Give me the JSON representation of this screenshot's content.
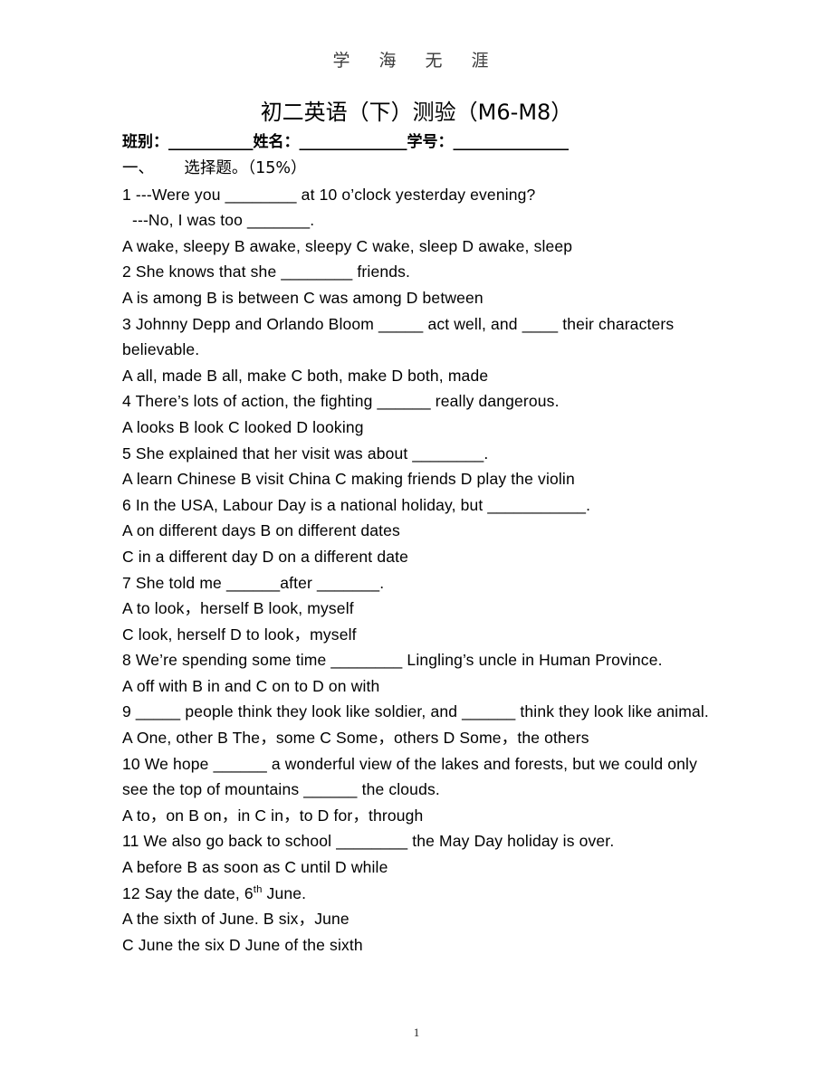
{
  "header": {
    "watermark": "学 海 无 涯"
  },
  "title": "初二英语（下）测验（M6-M8）",
  "info_line": "班别：___________姓名：______________学号：_______________",
  "section_heading": "一、      选择题。（15%）",
  "questions": [
    {
      "stem": "1 ---Were you ________ at 10 o’clock yesterday evening?",
      "stem2": "---No, I was too _______.",
      "options": "A wake, sleepy        B awake, sleepy     C wake, sleep      D awake, sleep"
    },
    {
      "stem": "2 She knows that she ________ friends.",
      "options": "A is among          B is between       C was among      D between"
    },
    {
      "stem": "3 Johnny Depp and Orlando Bloom _____ act well, and ____ their characters believable.",
      "options": "A all, made         B all, make     C both, make      D both, made"
    },
    {
      "stem": "4 There’s lots of action, the fighting ______ really dangerous.",
      "options": "A looks         B look        C looked         D looking"
    },
    {
      "stem": "5 She explained that her visit was about ________.",
      "options": "A learn Chinese        B visit China     C making friends    D play the violin"
    },
    {
      "stem": "6 In the USA, Labour Day is a national holiday, but ___________.",
      "options_a": "A on different days            B on different dates",
      "options_b": "C in a different day             D on a different date"
    },
    {
      "stem": "7 She told me ______after _______.",
      "options_a": "A to look，herself         B look,  myself",
      "options_b": "C look,  herself            D to look，myself"
    },
    {
      "stem": "8 We’re spending some time ________ Lingling’s uncle in Human Province.",
      "options": "A off  with       B in  and      C on  to       D on  with"
    },
    {
      "stem": "9 _____ people think they look like soldier, and ______ think they look like animal.",
      "options": "A  One, other    B The，some    C Some，others    D Some，the others"
    },
    {
      "stem": "10 We hope ______ a wonderful view of the lakes and forests, but we could only see the top of mountains ______ the clouds.",
      "options": "A to，on    B on，in    C in，to    D for，through"
    },
    {
      "stem": "11 We also go back to school ________ the May Day holiday is over.",
      "options": "A before    B as soon as    C until      D while"
    },
    {
      "stem_pre": "12 Say the date, 6",
      "stem_sup": "th",
      "stem_post": " June.",
      "options_a": "A the sixth of June.        B six，June",
      "options_b": "C June the six             D June of the sixth"
    }
  ],
  "page_number": "1"
}
